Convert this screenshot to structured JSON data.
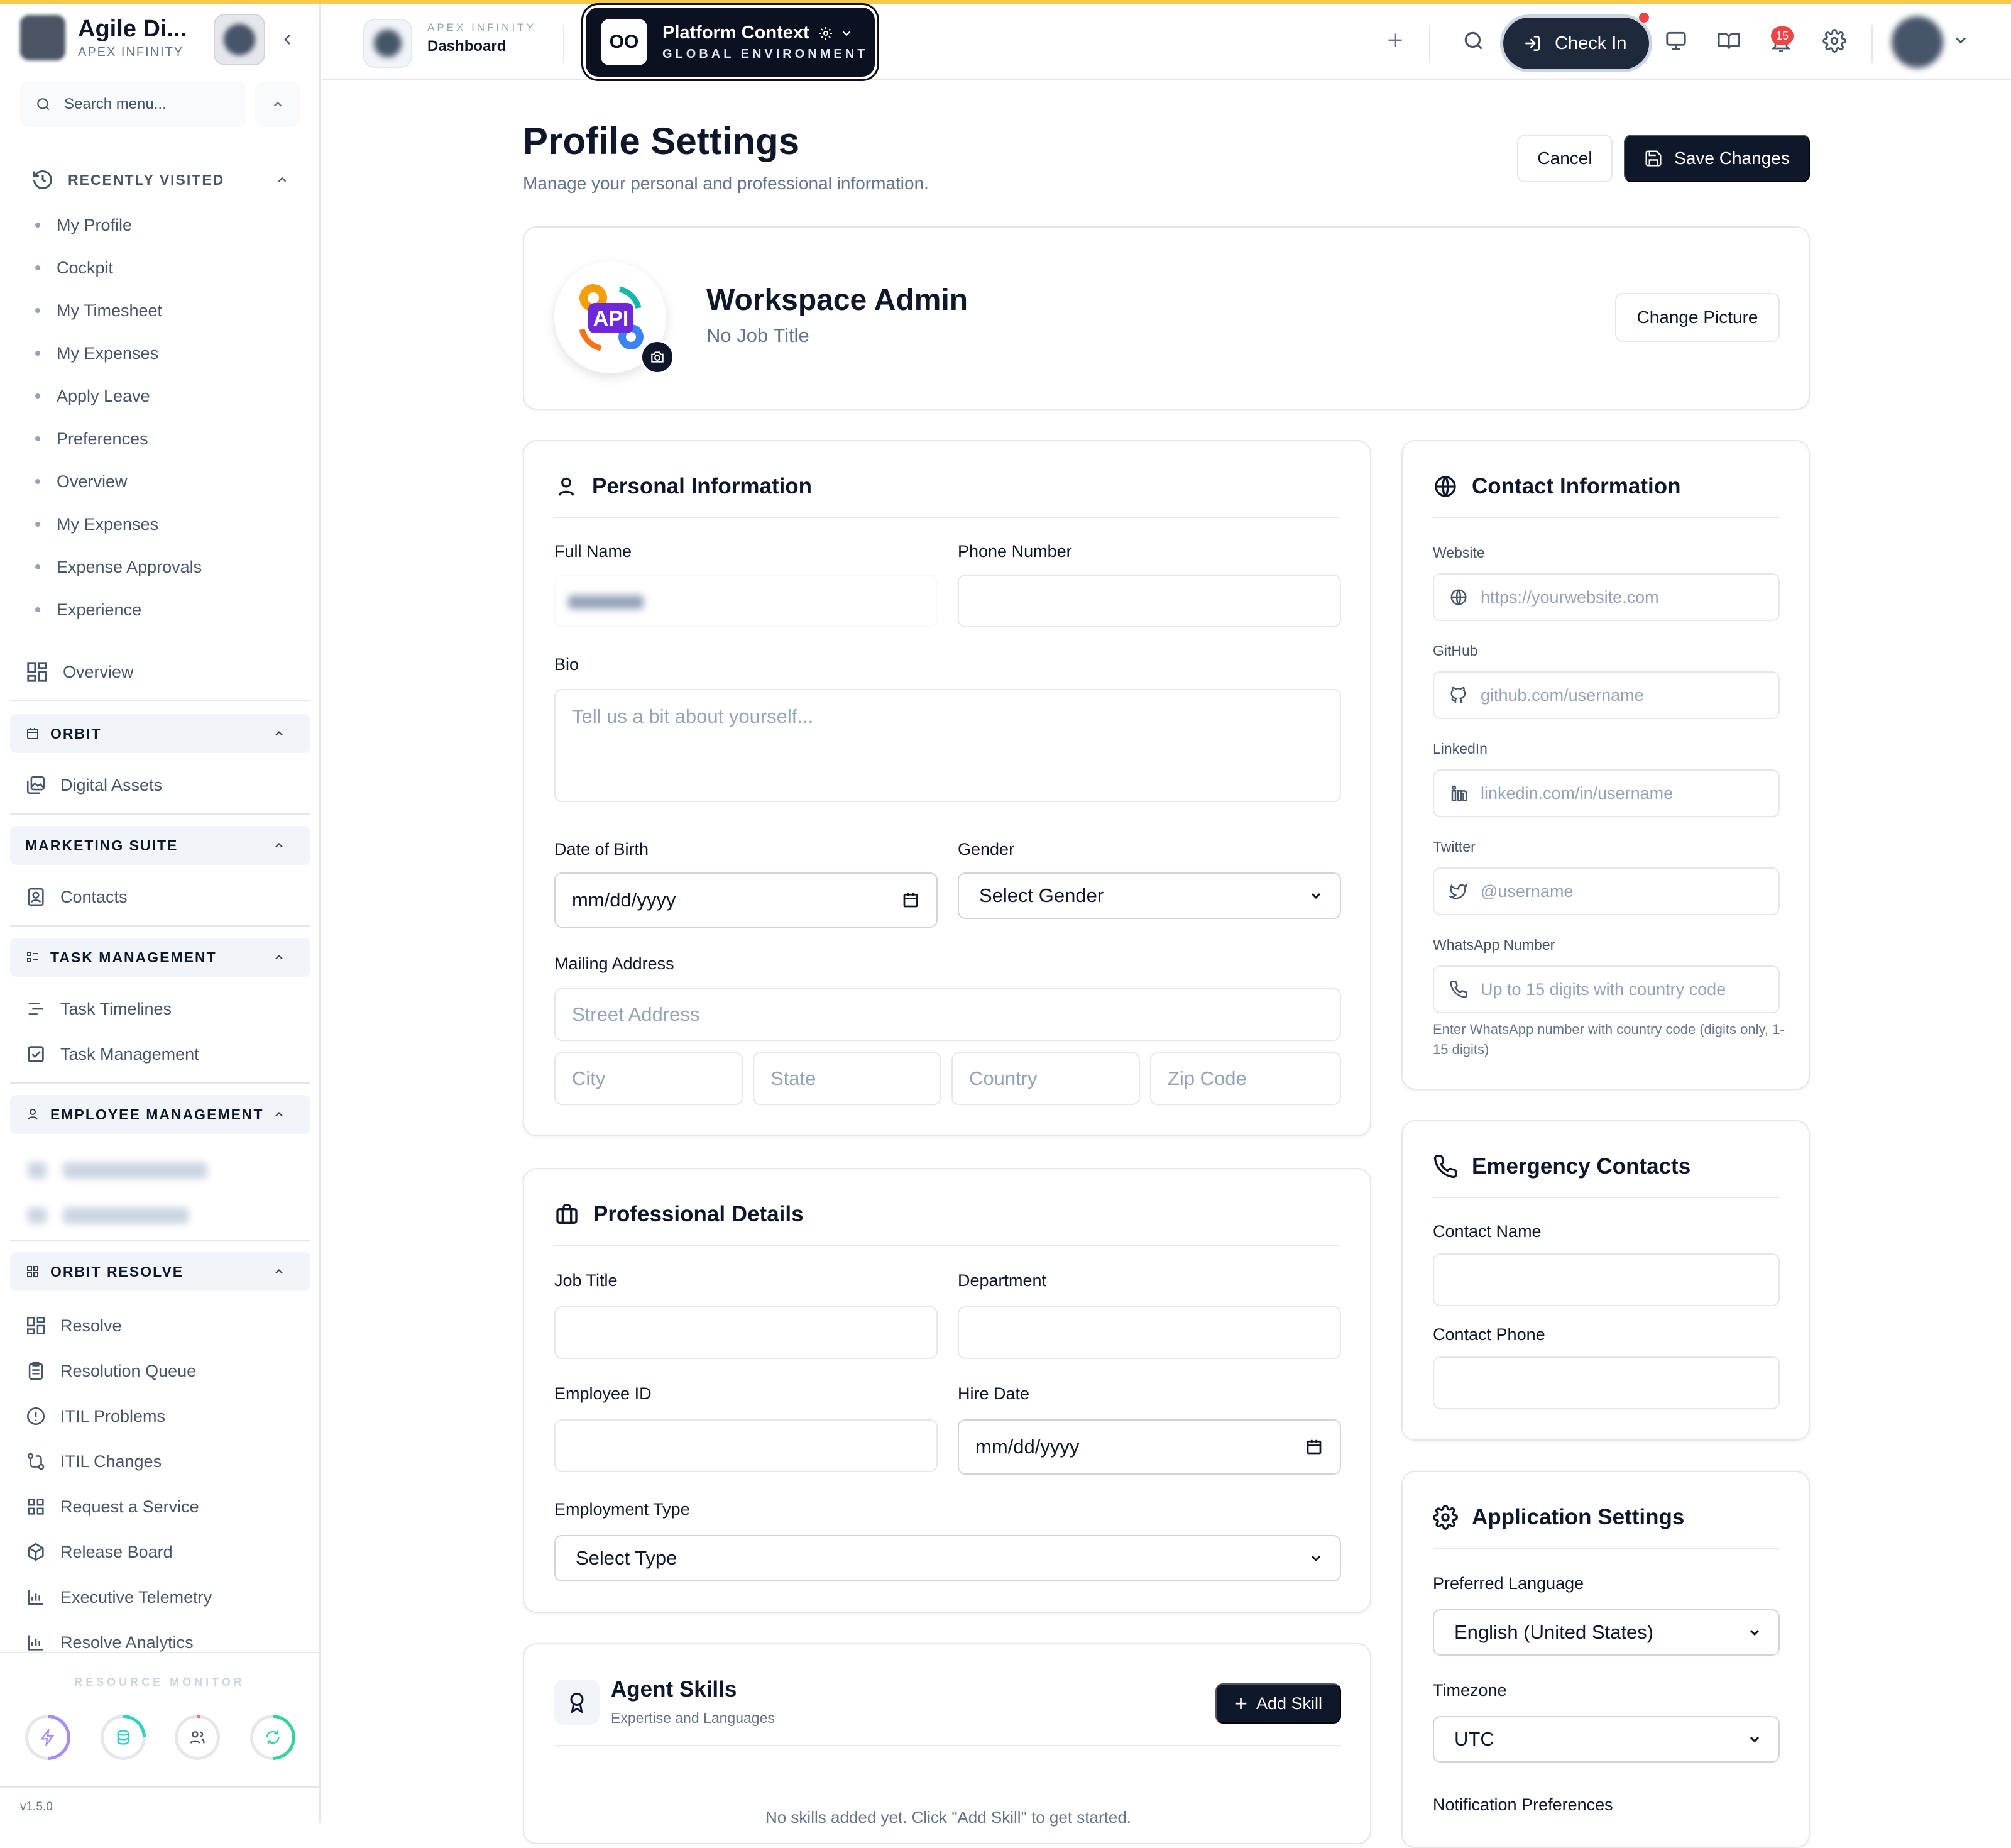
{
  "brand": {
    "name": "Agile Di...",
    "sub": "APEX INFINITY"
  },
  "sidebar": {
    "search_placeholder": "Search menu...",
    "recently_visited": {
      "title": "RECENTLY VISITED",
      "items": [
        "My Profile",
        "Cockpit",
        "My Timesheet",
        "My Expenses",
        "Apply Leave",
        "Preferences",
        "Overview",
        "My Expenses",
        "Expense Approvals",
        "Experience"
      ]
    },
    "overview": "Overview",
    "orbit": {
      "title": "ORBIT",
      "items": [
        "Digital Assets"
      ]
    },
    "marketing": {
      "title": "MARKETING SUITE",
      "items": [
        "Contacts"
      ]
    },
    "task": {
      "title": "TASK MANAGEMENT",
      "items": [
        "Task Timelines",
        "Task Management"
      ]
    },
    "employee": {
      "title": "EMPLOYEE MANAGEMENT"
    },
    "resolve": {
      "title": "ORBIT RESOLVE",
      "items": [
        "Resolve",
        "Resolution Queue",
        "ITIL Problems",
        "ITIL Changes",
        "Request a Service",
        "Release Board",
        "Executive Telemetry",
        "Resolve Analytics"
      ]
    },
    "resource_monitor": "RESOURCE MONITOR",
    "gauges": [
      {
        "name": "cpu",
        "color": "#a78bfa",
        "level": 0.5
      },
      {
        "name": "storage",
        "color": "#2dd4bf",
        "level": 0.25
      },
      {
        "name": "users",
        "color": "#f87171",
        "level": 0.02
      },
      {
        "name": "sync",
        "color": "#34d399",
        "level": 0.5
      }
    ],
    "version": "v1.5.0"
  },
  "topbar": {
    "crumb_sup": "APEX INFINITY",
    "crumb_main": "Dashboard",
    "context_logo": "OO",
    "context_title": "Platform Context",
    "context_sub": "GLOBAL ENVIRONMENT",
    "check_in": "Check In",
    "notifications": "15"
  },
  "page": {
    "title": "Profile Settings",
    "subtitle": "Manage your personal and professional information.",
    "cancel": "Cancel",
    "save": "Save Changes"
  },
  "profile": {
    "name": "Workspace Admin",
    "job": "No Job Title",
    "change_picture": "Change Picture",
    "avatar_text": "API"
  },
  "personal": {
    "title": "Personal Information",
    "full_name_label": "Full Name",
    "phone_label": "Phone Number",
    "bio_label": "Bio",
    "bio_placeholder": "Tell us a bit about yourself...",
    "dob_label": "Date of Birth",
    "dob_value": "mm/dd/yyyy",
    "gender_label": "Gender",
    "gender_value": "Select Gender",
    "address_label": "Mailing Address",
    "street_placeholder": "Street Address",
    "city_placeholder": "City",
    "state_placeholder": "State",
    "country_placeholder": "Country",
    "zip_placeholder": "Zip Code"
  },
  "professional": {
    "title": "Professional Details",
    "job_title_label": "Job Title",
    "department_label": "Department",
    "employee_id_label": "Employee ID",
    "hire_date_label": "Hire Date",
    "hire_date_value": "mm/dd/yyyy",
    "employment_type_label": "Employment Type",
    "employment_type_value": "Select Type"
  },
  "skills": {
    "title": "Agent Skills",
    "subtitle": "Expertise and Languages",
    "add": "Add Skill",
    "empty": "No skills added yet. Click \"Add Skill\" to get started."
  },
  "contact": {
    "title": "Contact Information",
    "website_label": "Website",
    "website_placeholder": "https://yourwebsite.com",
    "github_label": "GitHub",
    "github_placeholder": "github.com/username",
    "linkedin_label": "LinkedIn",
    "linkedin_placeholder": "linkedin.com/in/username",
    "twitter_label": "Twitter",
    "twitter_placeholder": "@username",
    "whatsapp_label": "WhatsApp Number",
    "whatsapp_placeholder": "Up to 15 digits with country code",
    "whatsapp_help": "Enter WhatsApp number with country code (digits only, 1-15 digits)"
  },
  "emergency": {
    "title": "Emergency Contacts",
    "name_label": "Contact Name",
    "phone_label": "Contact Phone"
  },
  "app_settings": {
    "title": "Application Settings",
    "language_label": "Preferred Language",
    "language_value": "English (United States)",
    "timezone_label": "Timezone",
    "timezone_value": "UTC",
    "notif_label": "Notification Preferences"
  }
}
